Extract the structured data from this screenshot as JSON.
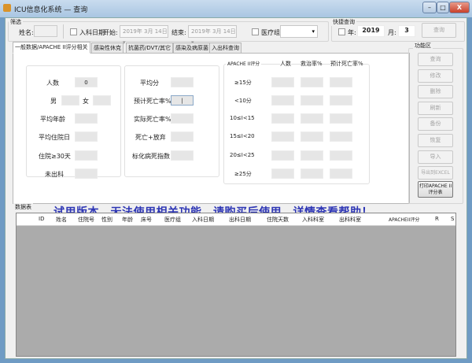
{
  "window": {
    "title": "ICU信息化系统 — 查询",
    "minimize": "–",
    "maximize": "□",
    "close": "X"
  },
  "filter": {
    "label": "筛选",
    "name_label": "姓名:",
    "admit_date_label": "入科日期:",
    "start_label": "开始:",
    "start_value": "2019年 3月 14日",
    "end_label": "结束:",
    "end_value": "2019年 3月 14日",
    "team_label": "医疗组:"
  },
  "quick": {
    "label": "快捷查询",
    "year_label": "年:",
    "year_value": "2019",
    "month_label": "月:",
    "month_value": "3",
    "query_button": "查询"
  },
  "tabs": [
    "一般数据/APACHE II评分相关",
    "感染性休克",
    "抗菌药/DVT/其它",
    "感染及病原菌",
    "入出科查询"
  ],
  "general": {
    "count_label": "人数",
    "count_value": "0",
    "male_label": "男",
    "female_label": "女",
    "avg_age_label": "平均年龄",
    "avg_stay_label": "平均住院日",
    "stay30_label": "住院≥30天",
    "not_out_label": "未出科"
  },
  "scores": {
    "avg_score_label": "平均分",
    "pred_mort_label": "预计死亡率%",
    "actual_mort_label": "实际死亡率%",
    "death_abandon_label": "死亡+放弃",
    "std_mort_label": "标化病死指数"
  },
  "apache": {
    "header": [
      "APACHE II评分",
      "人数",
      "救治率%",
      "预计死亡率%"
    ],
    "rows": [
      "≥15分",
      "<10分",
      "10≤I<15",
      "15≤I<20",
      "20≤I<25",
      "≥25分"
    ]
  },
  "notice": "试用版本，无法使用相关功能，请购买后使用，详情查看帮助！",
  "functions": {
    "label": "功能区",
    "buttons": [
      "查询",
      "修改",
      "删除",
      "刷新",
      "备份",
      "恢复",
      "导入",
      "导出到EXCEL"
    ],
    "print_button": "打印APACHE II评分表"
  },
  "table": {
    "label": "数据表",
    "columns": [
      "ID",
      "姓名",
      "住院号",
      "性别",
      "年龄",
      "床号",
      "医疗组",
      "入科日期",
      "出科日期",
      "住院天数",
      "入科科室",
      "出科科室",
      "APACHEII评分",
      "R",
      "S"
    ]
  }
}
